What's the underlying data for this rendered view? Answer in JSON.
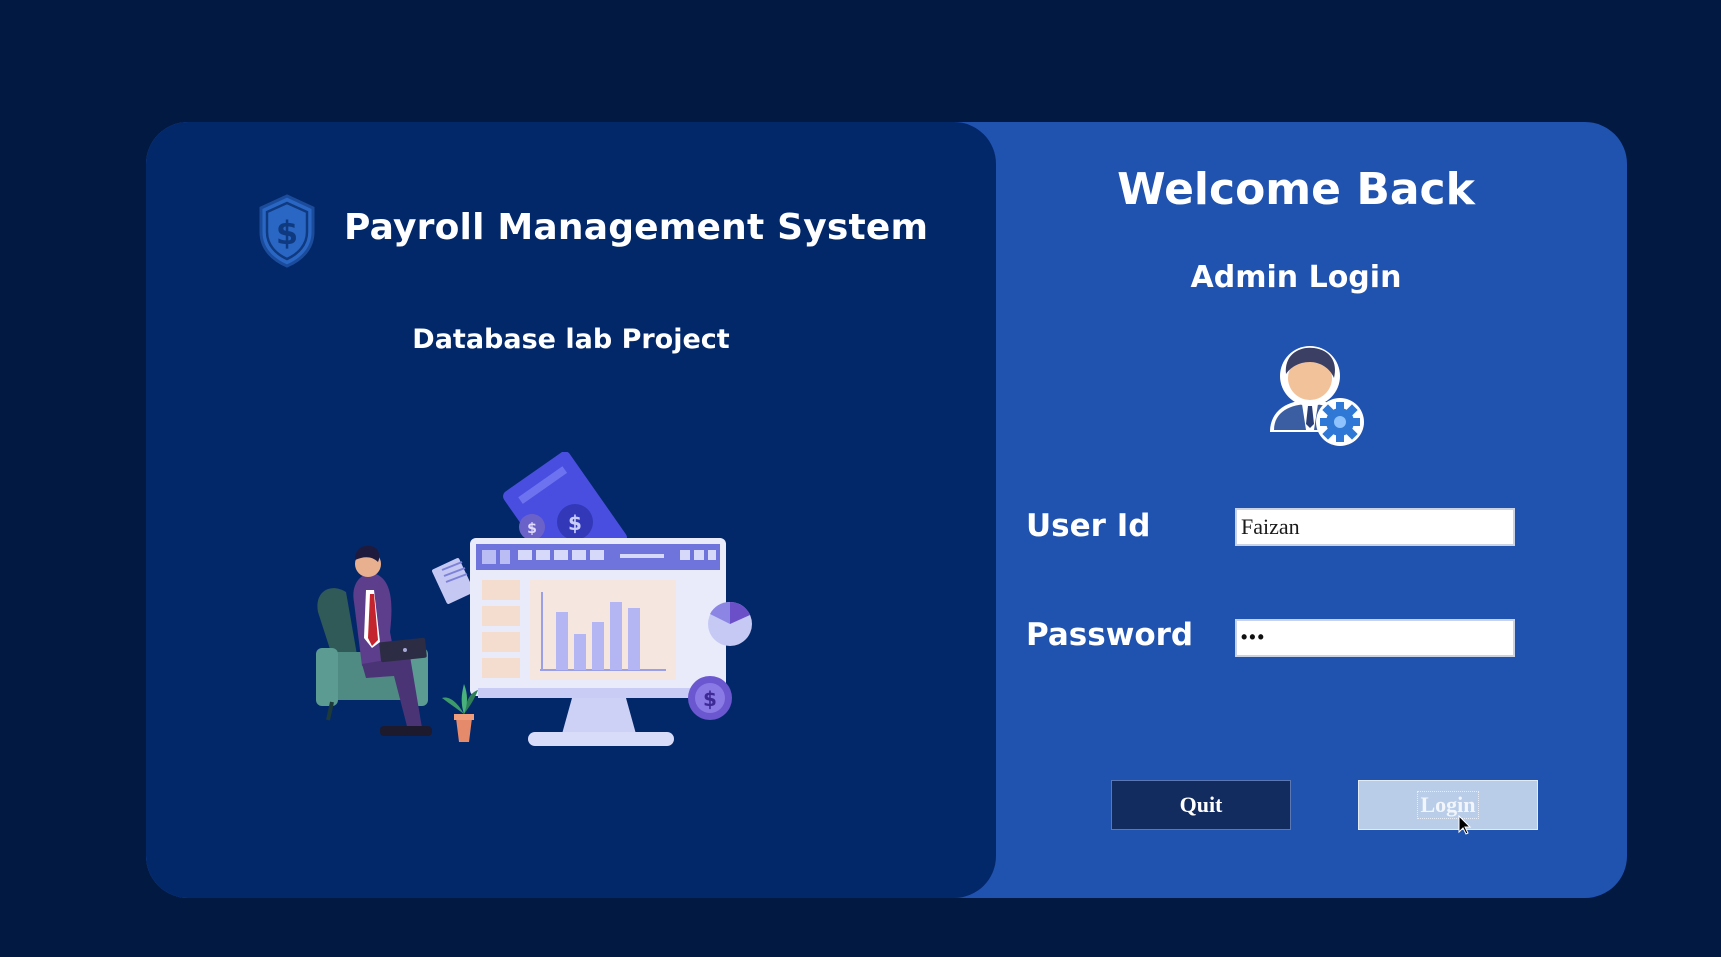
{
  "left_panel": {
    "title": "Payroll Management System",
    "subtitle": "Database lab Project",
    "logo_icon": "shield-dollar-icon",
    "illustration": "businessman-with-laptop-and-dashboard-monitor"
  },
  "right_panel": {
    "heading": "Welcome Back",
    "subheading": "Admin Login",
    "avatar_icon": "admin-user-gear-icon",
    "user_id": {
      "label": "User Id",
      "value": "Faizan"
    },
    "password": {
      "label": "Password",
      "masked_value": "•••"
    },
    "buttons": {
      "quit_label": "Quit",
      "login_label": "Login"
    }
  },
  "colors": {
    "background": "#021a42",
    "left_panel": "#03286a",
    "right_panel": "#2052b0",
    "quit_button": "#132c60",
    "login_button": "#b9cde9"
  }
}
